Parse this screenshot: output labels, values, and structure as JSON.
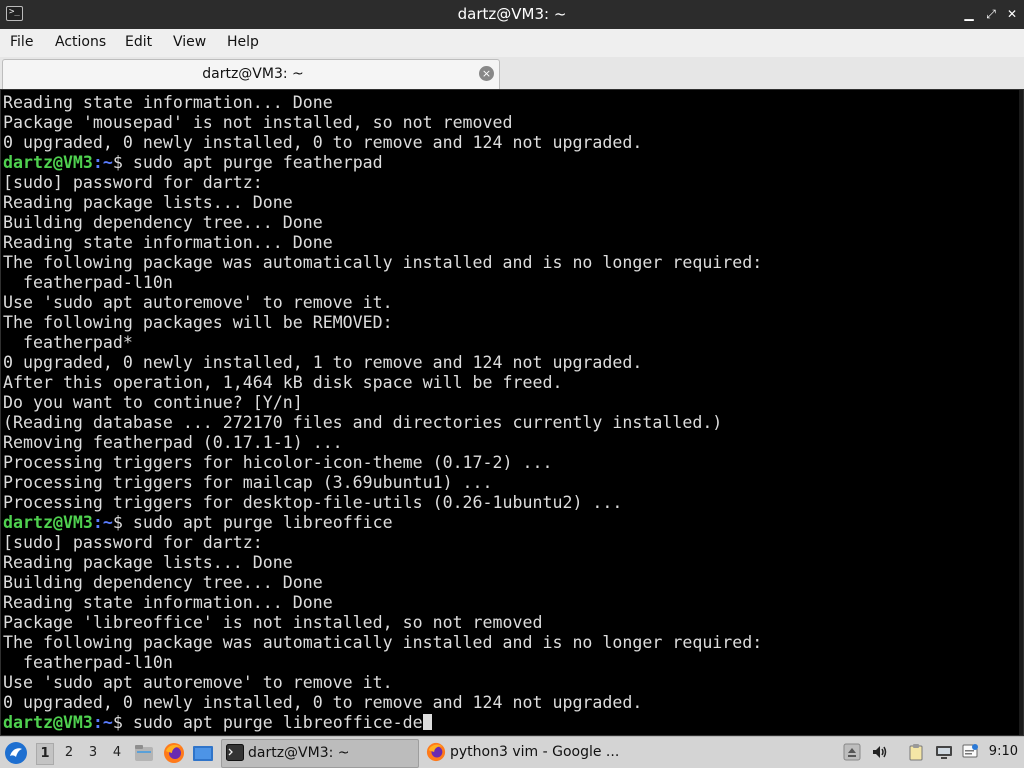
{
  "window": {
    "title": "dartz@VM3: ~"
  },
  "menu": [
    "File",
    "Actions",
    "Edit",
    "View",
    "Help"
  ],
  "tab": {
    "label": "dartz@VM3: ~",
    "close": "×"
  },
  "prompt": {
    "user_host": "dartz@VM3",
    "path": ":~",
    "symbol": "$"
  },
  "terminal_lines": [
    "Reading state information... Done",
    "Package 'mousepad' is not installed, so not removed",
    "0 upgraded, 0 newly installed, 0 to remove and 124 not upgraded.",
    {
      "cmd": "sudo apt purge featherpad"
    },
    "[sudo] password for dartz:",
    "Reading package lists... Done",
    "Building dependency tree... Done",
    "Reading state information... Done",
    "The following package was automatically installed and is no longer required:",
    "  featherpad-l10n",
    "Use 'sudo apt autoremove' to remove it.",
    "The following packages will be REMOVED:",
    "  featherpad*",
    "0 upgraded, 0 newly installed, 1 to remove and 124 not upgraded.",
    "After this operation, 1,464 kB disk space will be freed.",
    "Do you want to continue? [Y/n]",
    "(Reading database ... 272170 files and directories currently installed.)",
    "Removing featherpad (0.17.1-1) ...",
    "Processing triggers for hicolor-icon-theme (0.17-2) ...",
    "Processing triggers for mailcap (3.69ubuntu1) ...",
    "Processing triggers for desktop-file-utils (0.26-1ubuntu2) ...",
    {
      "cmd": "sudo apt purge libreoffice"
    },
    "[sudo] password for dartz:",
    "Reading package lists... Done",
    "Building dependency tree... Done",
    "Reading state information... Done",
    "Package 'libreoffice' is not installed, so not removed",
    "The following package was automatically installed and is no longer required:",
    "  featherpad-l10n",
    "Use 'sudo apt autoremove' to remove it.",
    "0 upgraded, 0 newly installed, 0 to remove and 124 not upgraded.",
    {
      "cmd": "sudo apt purge libreoffice-de",
      "cursor": true
    }
  ],
  "taskbar": {
    "workspaces": [
      "1",
      "2",
      "3",
      "4"
    ],
    "active_workspace": "1",
    "tasks": [
      {
        "label": "dartz@VM3: ~",
        "icon": "terminal-icon",
        "active": true
      },
      {
        "label": "python3 vim - Google ...",
        "icon": "firefox-icon",
        "active": false
      }
    ],
    "clock": "9:10"
  },
  "colors": {
    "prompt_user": "#4fd14f",
    "prompt_path": "#5a7cff",
    "terminal_bg": "#000000",
    "terminal_fg": "#dddddd",
    "titlebar_bg": "#2c2c2c"
  }
}
